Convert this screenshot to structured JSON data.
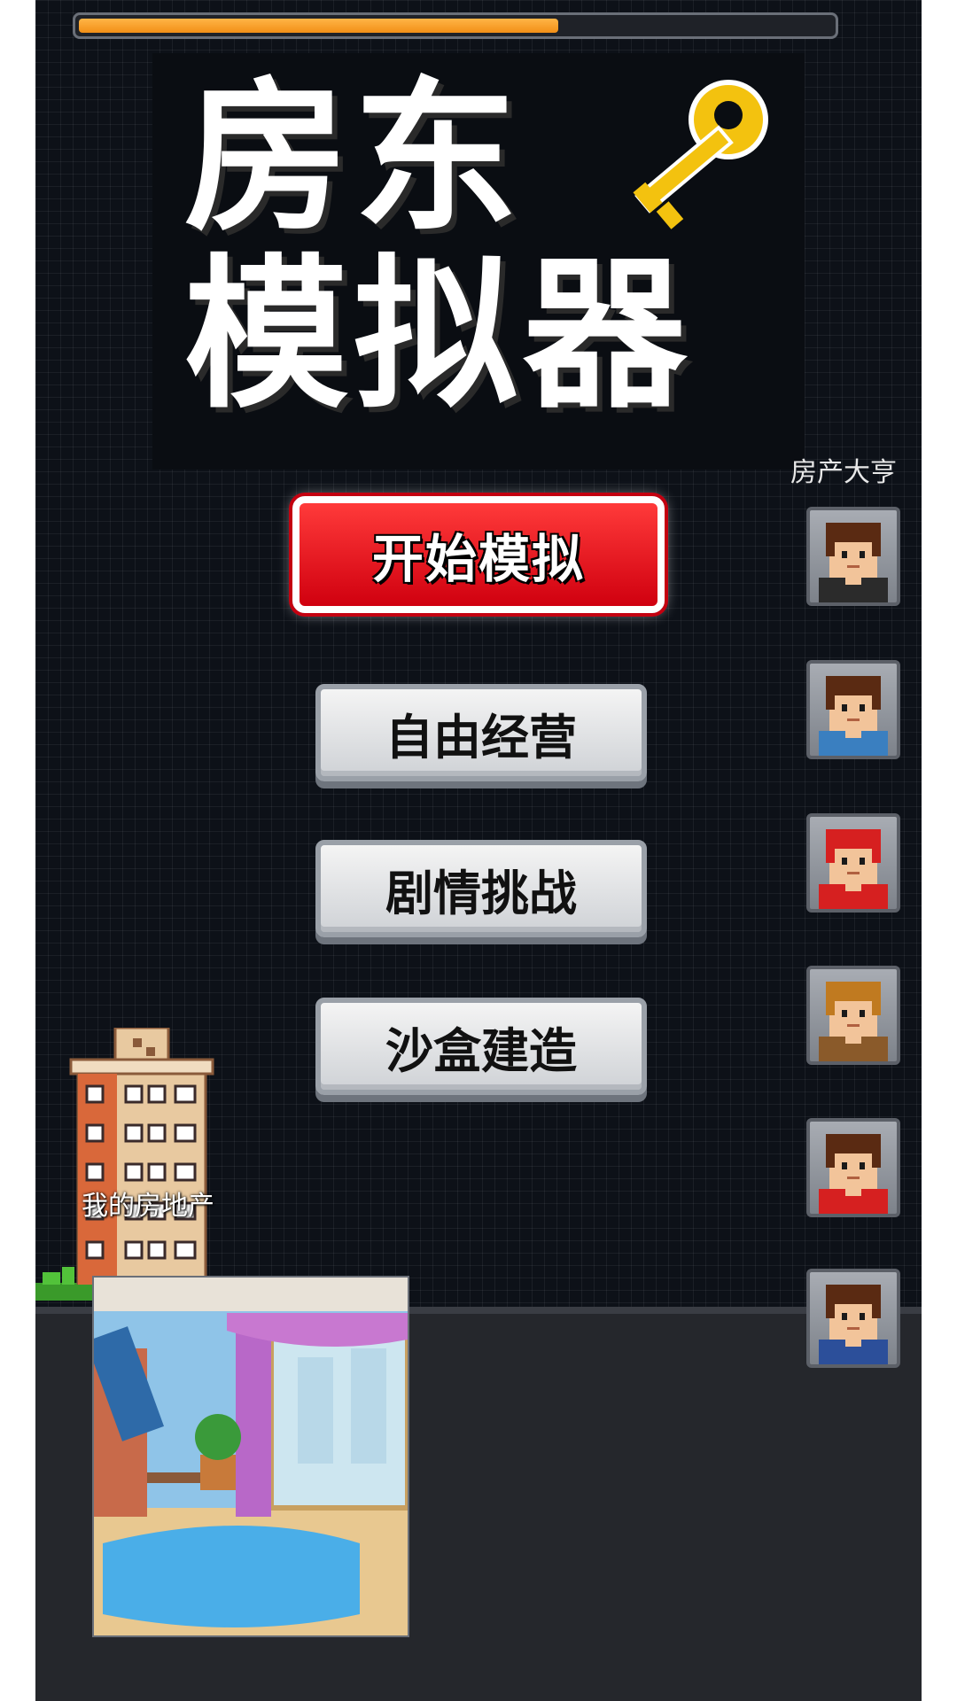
{
  "progress": {
    "value": 0.64,
    "color": "#f5a02a"
  },
  "title": {
    "line1": "房东",
    "line2": "模拟器",
    "icon": "key-icon"
  },
  "leaderboard": {
    "label": "房产大亨",
    "avatars": [
      {
        "name": "avatar-1",
        "shirt": "#2b2b2b",
        "hair": "#5a2a12"
      },
      {
        "name": "avatar-2",
        "shirt": "#3a7fc0",
        "hair": "#5a2a12"
      },
      {
        "name": "avatar-3",
        "shirt": "#d62020",
        "hair": "#d62020"
      },
      {
        "name": "avatar-4",
        "shirt": "#8a5a2a",
        "hair": "#c07a20"
      },
      {
        "name": "avatar-5",
        "shirt": "#d62020",
        "hair": "#5a2a12"
      },
      {
        "name": "avatar-6",
        "shirt": "#2c4f9a",
        "hair": "#5a2a12"
      }
    ]
  },
  "menu": {
    "start": "开始模拟",
    "free": "自由经营",
    "story": "剧情挑战",
    "sandbox": "沙盒建造"
  },
  "estate": {
    "label": "我的房地产"
  },
  "colors": {
    "start_red": "#e8101c",
    "background": "#0d1118",
    "floor": "#25272c"
  }
}
